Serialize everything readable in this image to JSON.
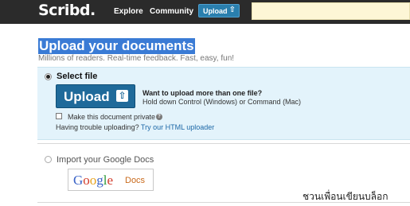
{
  "nav": {
    "logo": "Scribd.",
    "explore": "Explore",
    "community": "Community",
    "upload": "Upload"
  },
  "colors": {
    "topbar": "#2b2b2b",
    "accent": "#2a7fae",
    "panel": "#e3f3fb",
    "link": "#1d68a7"
  },
  "main": {
    "title": "Upload your documents",
    "subtitle": "Millions of readers. Real-time feedback. Fast, easy, fun!",
    "select_file": {
      "label": "Select file",
      "button": "Upload",
      "multi_question": "Want to upload more than one file?",
      "multi_hint": "Hold down Control (Windows) or Command (Mac)",
      "private_label": "Make this document private",
      "trouble_text": "Having trouble uploading?",
      "trouble_link": "Try our HTML uploader"
    },
    "google": {
      "label": "Import your Google Docs",
      "logo": [
        "G",
        "o",
        "o",
        "g",
        "l",
        "e"
      ],
      "docs": "Docs"
    }
  },
  "watermark": "ชวนเพื่อนเขียนบล็อก",
  "icons": {
    "upload_arrow": "arrow-up-icon",
    "help": "question-icon"
  }
}
